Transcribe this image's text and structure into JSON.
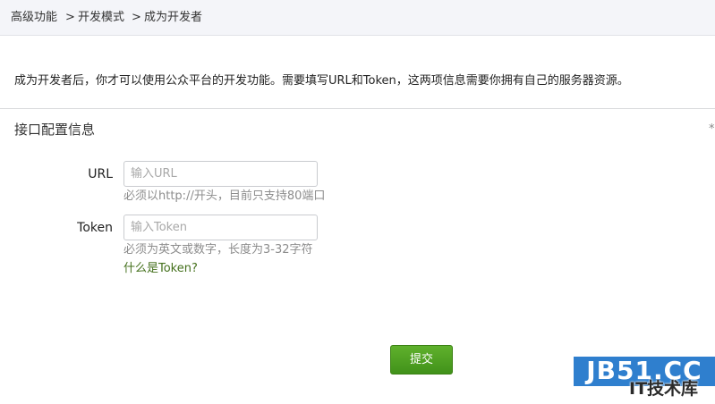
{
  "breadcrumb": {
    "items": [
      "高级功能",
      "开发模式",
      "成为开发者"
    ],
    "separator": ">"
  },
  "intro_text": "成为开发者后，你才可以使用公众平台的开发功能。需要填写URL和Token，这两项信息需要你拥有自己的服务器资源。",
  "section": {
    "title": "接口配置信息",
    "marker": "*"
  },
  "form": {
    "url": {
      "label": "URL",
      "placeholder": "输入URL",
      "value": "",
      "hint": "必须以http://开头，目前只支持80端口"
    },
    "token": {
      "label": "Token",
      "placeholder": "输入Token",
      "value": "",
      "hint": "必须为英文或数字，长度为3-32字符",
      "help_link": "什么是Token?"
    },
    "submit_label": "提交"
  },
  "watermark": {
    "main": "JB51.CC",
    "sub": "IT技术库"
  },
  "colors": {
    "accent_green": "#41921a",
    "link_green": "#44701c",
    "breadcrumb_bg": "#f4f5f9",
    "watermark_blue": "#2f7fce"
  }
}
